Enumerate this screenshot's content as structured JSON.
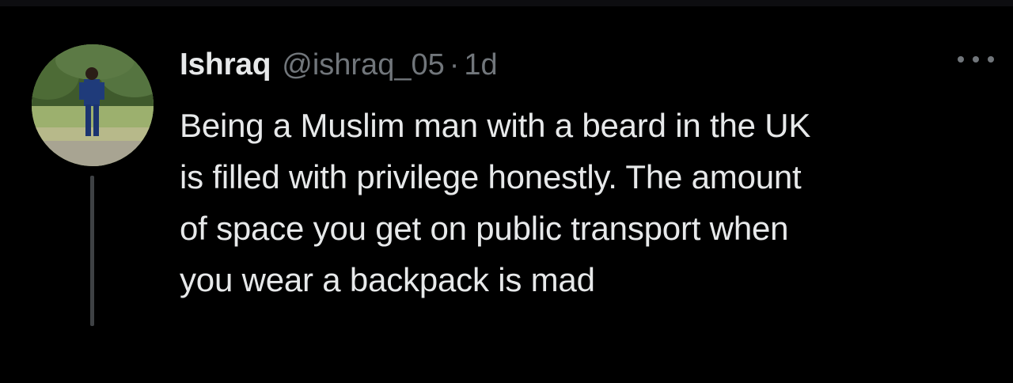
{
  "tweet": {
    "author": {
      "display_name": "Ishraq",
      "handle": "@ishraq_05",
      "avatar_icon": "profile-photo"
    },
    "separator": "·",
    "age": "1d",
    "text_lines": [
      "Being a Muslim man with a beard in the UK",
      "is filled with privilege honestly. The amount",
      "of space you get on public transport when",
      "you wear a backpack is mad"
    ],
    "more_icon": "more-options-icon"
  },
  "colors": {
    "background": "#000000",
    "primary_text": "#e7e9ea",
    "secondary_text": "#71767b",
    "thread_line": "#3e4144"
  }
}
